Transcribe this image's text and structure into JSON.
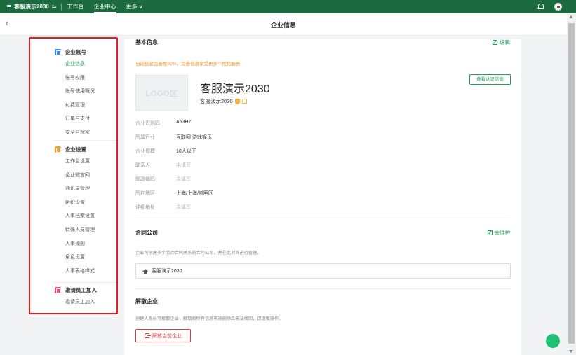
{
  "topbar": {
    "org_name": "客服演示2030",
    "switch_symbol": "⇆",
    "nav": [
      {
        "label": "工作台"
      },
      {
        "label": "企业中心"
      },
      {
        "label": "更多 ∨"
      }
    ]
  },
  "header": {
    "back_symbol": "‹",
    "title": "企业信息"
  },
  "sidebar": {
    "groups": [
      {
        "title": "企业账号",
        "items": [
          "企业信息",
          "账号权限",
          "账号使用概况",
          "付费管理",
          "订单与支付",
          "安全与保密"
        ]
      },
      {
        "title": "企业设置",
        "items": [
          "工作台设置",
          "企业微官网",
          "通讯录管理",
          "组织设置",
          "人事档案设置",
          "特殊人员管理",
          "人事规则",
          "角色设置",
          "人事表格样式"
        ]
      },
      {
        "title": "邀请员工加入",
        "items": [
          "邀请员工加入"
        ]
      }
    ]
  },
  "basic_info": {
    "title": "基本信息",
    "edit_label": "编辑",
    "notice": "当前信息完善度60%，完善信息享受更多个性化服务",
    "logo_text": "LOGO区",
    "company_name": "客服演示2030",
    "company_short": "客服演示2030",
    "view_cert_label": "查看认证信息",
    "fields": [
      {
        "label": "企业识别码",
        "value": "A53HZ",
        "empty": false
      },
      {
        "label": "所属行业",
        "value": "互联网 游戏娱乐",
        "empty": false
      },
      {
        "label": "企业规模",
        "value": "10人以下",
        "empty": false
      },
      {
        "label": "联系人",
        "value": "未填写",
        "empty": true
      },
      {
        "label": "邮政编码",
        "value": "未填写",
        "empty": true
      },
      {
        "label": "所在地区",
        "value": "上海/上海/崇明区",
        "empty": false
      },
      {
        "label": "详细地址",
        "value": "未填写",
        "empty": true
      }
    ]
  },
  "contract": {
    "title": "合同公司",
    "maintain_label": "去维护",
    "desc": "企业可创建多个劳动合同关系的合同公司，并在此对其进行管理。",
    "company": "客服演示2030"
  },
  "dissolve": {
    "title": "解散企业",
    "desc": "创建人身份可解散企业，解散后所有信息将被删除且无法找回，请谨慎操作。",
    "button_label": "解散当前企业"
  },
  "colors": {
    "brand": "#1b6b3f",
    "accent": "#1d9e58",
    "warn": "#f08a1c",
    "danger": "#e4393c"
  }
}
